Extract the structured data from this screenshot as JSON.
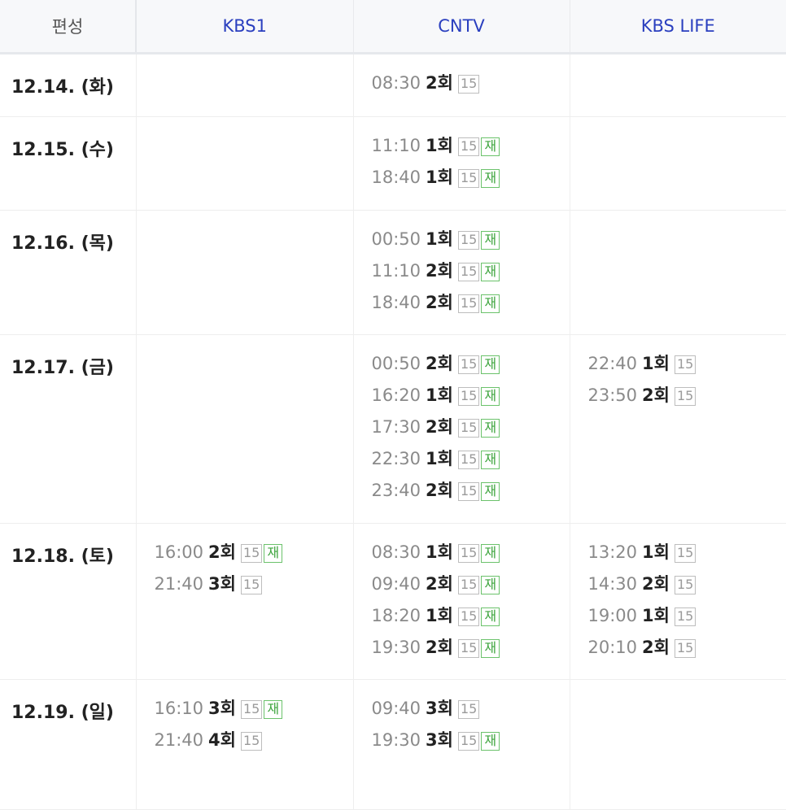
{
  "header": {
    "corner": "편성",
    "channels": [
      "KBS1",
      "CNTV",
      "KBS LIFE"
    ]
  },
  "rows": [
    {
      "date": "12.14. (화)",
      "height": 78,
      "cells": [
        [],
        [
          {
            "time": "08:30",
            "ep": "2회",
            "rating": "15"
          }
        ],
        []
      ]
    },
    {
      "date": "12.15. (수)",
      "height": 115,
      "cells": [
        [],
        [
          {
            "time": "11:10",
            "ep": "1회",
            "rating": "15",
            "rerun": "재"
          },
          {
            "time": "18:40",
            "ep": "1회",
            "rating": "15",
            "rerun": "재"
          }
        ],
        []
      ]
    },
    {
      "date": "12.16. (목)",
      "height": 153,
      "cells": [
        [],
        [
          {
            "time": "00:50",
            "ep": "1회",
            "rating": "15",
            "rerun": "재"
          },
          {
            "time": "11:10",
            "ep": "2회",
            "rating": "15",
            "rerun": "재"
          },
          {
            "time": "18:40",
            "ep": "2회",
            "rating": "15",
            "rerun": "재"
          }
        ],
        []
      ]
    },
    {
      "date": "12.17. (금)",
      "height": 232,
      "cells": [
        [],
        [
          {
            "time": "00:50",
            "ep": "2회",
            "rating": "15",
            "rerun": "재"
          },
          {
            "time": "16:20",
            "ep": "1회",
            "rating": "15",
            "rerun": "재"
          },
          {
            "time": "17:30",
            "ep": "2회",
            "rating": "15",
            "rerun": "재"
          },
          {
            "time": "22:30",
            "ep": "1회",
            "rating": "15",
            "rerun": "재"
          },
          {
            "time": "23:40",
            "ep": "2회",
            "rating": "15",
            "rerun": "재"
          }
        ],
        [
          {
            "time": "22:40",
            "ep": "1회",
            "rating": "15"
          },
          {
            "time": "23:50",
            "ep": "2회",
            "rating": "15"
          }
        ]
      ]
    },
    {
      "date": "12.18. (토)",
      "height": 192,
      "cells": [
        [
          {
            "time": "16:00",
            "ep": "2회",
            "rating": "15",
            "rerun": "재"
          },
          {
            "time": "21:40",
            "ep": "3회",
            "rating": "15"
          }
        ],
        [
          {
            "time": "08:30",
            "ep": "1회",
            "rating": "15",
            "rerun": "재"
          },
          {
            "time": "09:40",
            "ep": "2회",
            "rating": "15",
            "rerun": "재"
          },
          {
            "time": "18:20",
            "ep": "1회",
            "rating": "15",
            "rerun": "재"
          },
          {
            "time": "19:30",
            "ep": "2회",
            "rating": "15",
            "rerun": "재"
          }
        ],
        [
          {
            "time": "13:20",
            "ep": "1회",
            "rating": "15"
          },
          {
            "time": "14:30",
            "ep": "2회",
            "rating": "15"
          },
          {
            "time": "19:00",
            "ep": "1회",
            "rating": "15"
          },
          {
            "time": "20:10",
            "ep": "2회",
            "rating": "15"
          }
        ]
      ]
    },
    {
      "date": "12.19. (일)",
      "height": 160,
      "cells": [
        [
          {
            "time": "16:10",
            "ep": "3회",
            "rating": "15",
            "rerun": "재"
          },
          {
            "time": "21:40",
            "ep": "4회",
            "rating": "15"
          }
        ],
        [
          {
            "time": "09:40",
            "ep": "3회",
            "rating": "15"
          },
          {
            "time": "19:30",
            "ep": "3회",
            "rating": "15",
            "rerun": "재"
          }
        ],
        []
      ]
    }
  ]
}
